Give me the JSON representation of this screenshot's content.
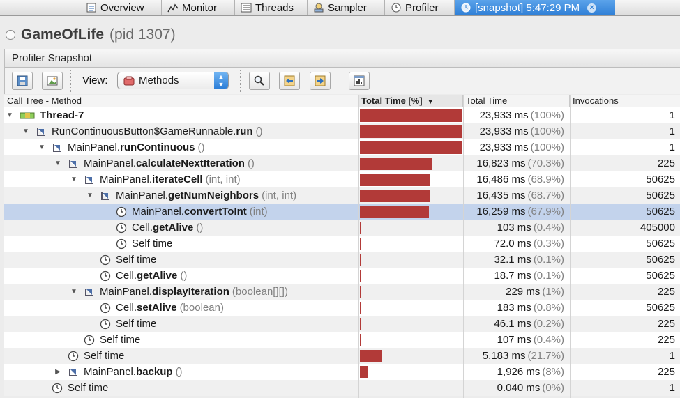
{
  "tabs": [
    {
      "label": "Overview",
      "icon": "overview-icon"
    },
    {
      "label": "Monitor",
      "icon": "monitor-icon"
    },
    {
      "label": "Threads",
      "icon": "threads-icon"
    },
    {
      "label": "Sampler",
      "icon": "sampler-icon"
    },
    {
      "label": "Profiler",
      "icon": "profiler-icon"
    },
    {
      "label": "[snapshot] 5:47:29 PM",
      "icon": "snapshot-icon",
      "active": true
    }
  ],
  "app": {
    "name": "GameOfLife",
    "pid": "(pid 1307)"
  },
  "panel_title": "Profiler Snapshot",
  "toolbar": {
    "view_label": "View:",
    "view_value": "Methods"
  },
  "columns": {
    "method": "Call Tree - Method",
    "total_time_pct": "Total Time [%]",
    "total_time": "Total Time",
    "invocations": "Invocations"
  },
  "rows": [
    {
      "indent": 0,
      "expander": "down",
      "icon": "thread-icon",
      "cls": "",
      "method": "Thread-7",
      "params": "",
      "pct": 100,
      "time": "23,933 ms",
      "pct_text": "(100%)",
      "inv": "1"
    },
    {
      "indent": 1,
      "expander": "down",
      "icon": "method-icon",
      "cls": "RunContinuousButton$GameRunnable.",
      "method": "run",
      "params": "()",
      "pct": 100,
      "time": "23,933 ms",
      "pct_text": "(100%)",
      "inv": "1"
    },
    {
      "indent": 2,
      "expander": "down",
      "icon": "method-icon",
      "cls": "MainPanel.",
      "method": "runContinuous",
      "params": "()",
      "pct": 100,
      "time": "23,933 ms",
      "pct_text": "(100%)",
      "inv": "1"
    },
    {
      "indent": 3,
      "expander": "down",
      "icon": "method-icon",
      "cls": "MainPanel.",
      "method": "calculateNextIteration",
      "params": "()",
      "pct": 70.3,
      "time": "16,823 ms",
      "pct_text": "(70.3%)",
      "inv": "225"
    },
    {
      "indent": 4,
      "expander": "down",
      "icon": "method-icon",
      "cls": "MainPanel.",
      "method": "iterateCell",
      "params": "(int, int)",
      "pct": 68.9,
      "time": "16,486 ms",
      "pct_text": "(68.9%)",
      "inv": "50625"
    },
    {
      "indent": 5,
      "expander": "down",
      "icon": "method-icon",
      "cls": "MainPanel.",
      "method": "getNumNeighbors",
      "params": "(int, int)",
      "pct": 68.7,
      "time": "16,435 ms",
      "pct_text": "(68.7%)",
      "inv": "50625"
    },
    {
      "indent": 6,
      "expander": "",
      "icon": "clock-icon",
      "cls": "MainPanel.",
      "method": "convertToInt",
      "params": "(int)",
      "pct": 67.9,
      "time": "16,259 ms",
      "pct_text": "(67.9%)",
      "inv": "50625",
      "selected": true
    },
    {
      "indent": 6,
      "expander": "",
      "icon": "clock-icon",
      "cls": "Cell.",
      "method": "getAlive",
      "params": "()",
      "pct": 0.4,
      "time": "103 ms",
      "pct_text": "(0.4%)",
      "inv": "405000"
    },
    {
      "indent": 6,
      "expander": "",
      "icon": "clock-icon",
      "cls": "Self time",
      "method": "",
      "params": "",
      "pct": 0.3,
      "time": "72.0 ms",
      "pct_text": "(0.3%)",
      "inv": "50625"
    },
    {
      "indent": 5,
      "expander": "",
      "icon": "clock-icon",
      "cls": "Self time",
      "method": "",
      "params": "",
      "pct": 0.1,
      "time": "32.1 ms",
      "pct_text": "(0.1%)",
      "inv": "50625"
    },
    {
      "indent": 5,
      "expander": "",
      "icon": "clock-icon",
      "cls": "Cell.",
      "method": "getAlive",
      "params": "()",
      "pct": 0.1,
      "time": "18.7 ms",
      "pct_text": "(0.1%)",
      "inv": "50625"
    },
    {
      "indent": 4,
      "expander": "down",
      "icon": "method-icon",
      "cls": "MainPanel.",
      "method": "displayIteration",
      "params": "(boolean[][])",
      "pct": 1,
      "time": "229 ms",
      "pct_text": "(1%)",
      "inv": "225"
    },
    {
      "indent": 5,
      "expander": "",
      "icon": "clock-icon",
      "cls": "Cell.",
      "method": "setAlive",
      "params": "(boolean)",
      "pct": 0.8,
      "time": "183 ms",
      "pct_text": "(0.8%)",
      "inv": "50625"
    },
    {
      "indent": 5,
      "expander": "",
      "icon": "clock-icon",
      "cls": "Self time",
      "method": "",
      "params": "",
      "pct": 0.2,
      "time": "46.1 ms",
      "pct_text": "(0.2%)",
      "inv": "225"
    },
    {
      "indent": 4,
      "expander": "",
      "icon": "clock-icon",
      "cls": "Self time",
      "method": "",
      "params": "",
      "pct": 0.4,
      "time": "107 ms",
      "pct_text": "(0.4%)",
      "inv": "225"
    },
    {
      "indent": 3,
      "expander": "",
      "icon": "clock-icon",
      "cls": "Self time",
      "method": "",
      "params": "",
      "pct": 21.7,
      "time": "5,183 ms",
      "pct_text": "(21.7%)",
      "inv": "1"
    },
    {
      "indent": 3,
      "expander": "right",
      "icon": "method-icon",
      "cls": "MainPanel.",
      "method": "backup",
      "params": "()",
      "pct": 8,
      "time": "1,926 ms",
      "pct_text": "(8%)",
      "inv": "225"
    },
    {
      "indent": 2,
      "expander": "",
      "icon": "clock-icon",
      "cls": "Self time",
      "method": "",
      "params": "",
      "pct": 0,
      "time": "0.040 ms",
      "pct_text": "(0%)",
      "inv": "1"
    }
  ],
  "colors": {
    "bar": "#b23a38",
    "selection": "#c3d3ec",
    "active_tab": "#3a8ae0"
  }
}
